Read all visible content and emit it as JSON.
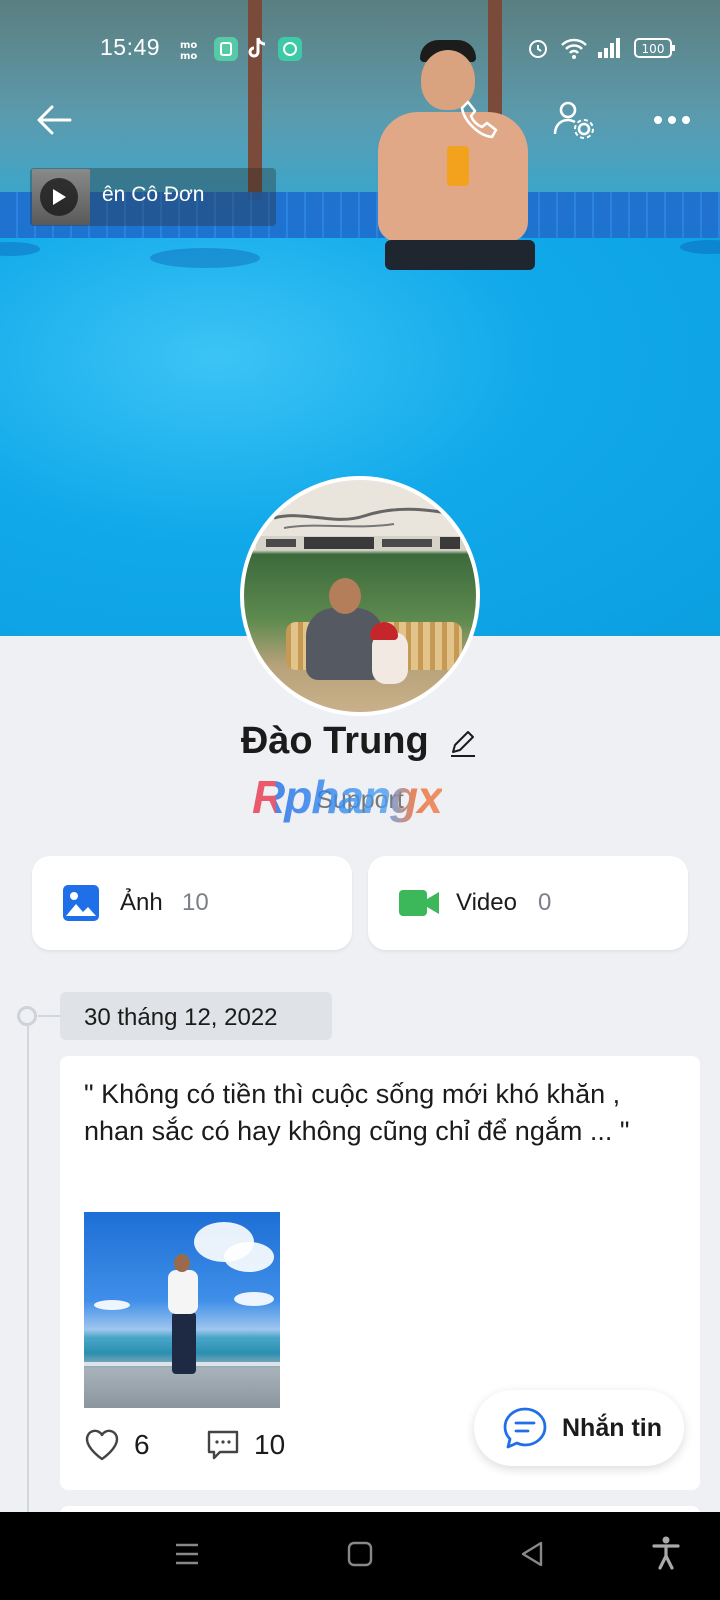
{
  "status_bar": {
    "time": "15:49",
    "left_icons": [
      "momo-icon",
      "app-icon",
      "tiktok-icon",
      "chat-icon"
    ],
    "right_icons": [
      "alarm-icon",
      "wifi-icon",
      "signal-icon"
    ],
    "battery": "100"
  },
  "header": {
    "back_icon": "back-arrow-icon",
    "call_icon": "phone-icon",
    "settings_icon": "user-settings-icon",
    "more_icon": "more-dots-icon"
  },
  "music": {
    "title": "ên Cô Đơn"
  },
  "profile": {
    "name": "Đào Trung",
    "subtitle": "Support",
    "watermark": "Rphangx"
  },
  "media": {
    "photos": {
      "label": "Ảnh",
      "count": "10"
    },
    "videos": {
      "label": "Video",
      "count": "0"
    }
  },
  "timeline": [
    {
      "date": "30 tháng 12, 2022",
      "text": "\" Không có tiền thì cuộc sống mới khó khăn , nhan sắc có hay không cũng chỉ để ngắm ... \"",
      "likes": "6",
      "comments": "10"
    }
  ],
  "fab": {
    "label": "Nhắn tin"
  },
  "colors": {
    "accent_blue": "#1f6fe8",
    "video_green": "#3cb85a",
    "background": "#eef0f3"
  }
}
